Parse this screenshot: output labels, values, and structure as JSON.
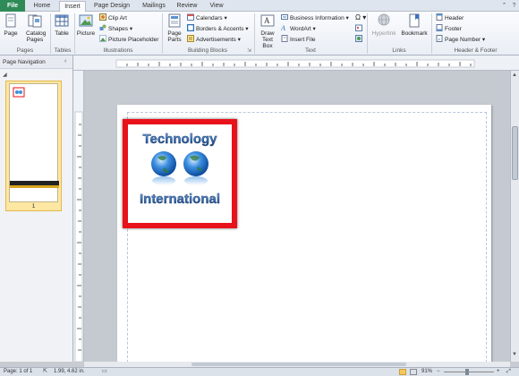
{
  "tabs": [
    {
      "label": "File"
    },
    {
      "label": "Home"
    },
    {
      "label": "Insert"
    },
    {
      "label": "Page Design"
    },
    {
      "label": "Mailings"
    },
    {
      "label": "Review"
    },
    {
      "label": "View"
    }
  ],
  "ribbon": {
    "pages": {
      "group": "Pages",
      "page": "Page",
      "catalog_pages": "Catalog Pages"
    },
    "tables": {
      "group": "Tables",
      "table": "Table"
    },
    "illustrations": {
      "group": "Illustrations",
      "picture": "Picture",
      "clip_art": "Clip Art",
      "shapes": "Shapes",
      "picture_placeholder": "Picture Placeholder"
    },
    "building_blocks": {
      "group": "Building Blocks",
      "page_parts": "Page Parts",
      "calendars": "Calendars",
      "borders_accents": "Borders & Accents",
      "advertisements": "Advertisements"
    },
    "text": {
      "group": "Text",
      "draw_text_box": "Draw Text Box",
      "business_information": "Business Information",
      "wordart": "WordArt",
      "insert_file": "Insert File"
    },
    "links": {
      "group": "Links",
      "hyperlink": "Hyperlink",
      "bookmark": "Bookmark"
    },
    "header_footer": {
      "group": "Header & Footer",
      "header": "Header",
      "footer": "Footer",
      "page_number": "Page Number"
    }
  },
  "nav": {
    "title": "Page Navigation",
    "page_number": "1"
  },
  "logo": {
    "line1": "Technology",
    "line2": "International"
  },
  "status": {
    "page": "Page: 1 of 1",
    "position": "1.99, 4.62 in.",
    "zoom": "91%"
  },
  "colors": {
    "accent": "#2e8b57",
    "frame": "#e8121a",
    "globe": "#1e78d2"
  }
}
